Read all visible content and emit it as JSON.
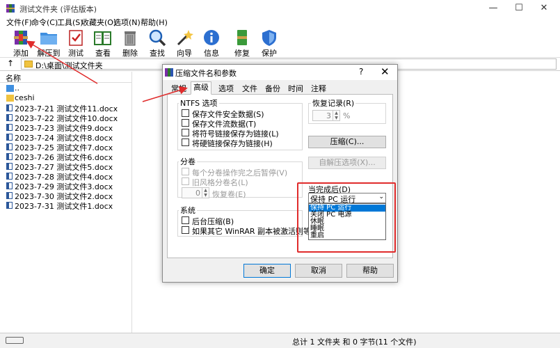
{
  "window": {
    "title": "测试文件夹 (评估版本)"
  },
  "menu": [
    "文件(F)",
    "命令(C)",
    "工具(S)",
    "收藏夹(O)",
    "选项(N)",
    "帮助(H)"
  ],
  "toolbar": [
    {
      "label": "添加",
      "icon": "add-archive-icon"
    },
    {
      "label": "解压到",
      "icon": "extract-folder-icon"
    },
    {
      "label": "测试",
      "icon": "test-icon"
    },
    {
      "label": "查看",
      "icon": "view-book-icon"
    },
    {
      "label": "删除",
      "icon": "trash-icon"
    },
    {
      "label": "查找",
      "icon": "magnifier-icon"
    },
    {
      "label": "向导",
      "icon": "wand-icon"
    },
    {
      "label": "信息",
      "icon": "info-icon"
    },
    {
      "label": "修复",
      "icon": "repair-icon"
    },
    {
      "label": "保护",
      "icon": "shield-icon"
    }
  ],
  "address": {
    "up": "↑",
    "path": "D:\\桌面\\测试文件夹"
  },
  "filelist": {
    "header": "名称",
    "items": [
      {
        "name": "..",
        "type": "up"
      },
      {
        "name": "ceshi",
        "type": "folder"
      },
      {
        "name": "2023-7-21 测试文件11.docx",
        "type": "docx"
      },
      {
        "name": "2023-7-22 测试文件10.docx",
        "type": "docx"
      },
      {
        "name": "2023-7-23 测试文件9.docx",
        "type": "docx"
      },
      {
        "name": "2023-7-24 测试文件8.docx",
        "type": "docx"
      },
      {
        "name": "2023-7-25 测试文件7.docx",
        "type": "docx"
      },
      {
        "name": "2023-7-26 测试文件6.docx",
        "type": "docx"
      },
      {
        "name": "2023-7-27 测试文件5.docx",
        "type": "docx"
      },
      {
        "name": "2023-7-28 测试文件4.docx",
        "type": "docx"
      },
      {
        "name": "2023-7-29 测试文件3.docx",
        "type": "docx"
      },
      {
        "name": "2023-7-30 测试文件2.docx",
        "type": "docx"
      },
      {
        "name": "2023-7-31 测试文件1.docx",
        "type": "docx"
      }
    ]
  },
  "status": {
    "text": "总计 1 文件夹 和 0 字节(11 个文件)"
  },
  "dialog": {
    "title": "压缩文件名和参数",
    "help": "?",
    "close": "✕",
    "tabs": [
      "常规",
      "高级",
      "选项",
      "文件",
      "备份",
      "时间",
      "注释"
    ],
    "active_tab": "高级",
    "ntfs": {
      "title": "NTFS 选项",
      "items": [
        "保存文件安全数据(S)",
        "保存文件流数据(T)",
        "将符号链接保存为链接(L)",
        "将硬链接保存为链接(H)"
      ]
    },
    "recovery": {
      "title": "恢复记录(R)",
      "value": "3",
      "unit": "%"
    },
    "compress_button": "压缩(C)...",
    "sfx_button": "自解压选项(X)...",
    "split": {
      "title": "分卷",
      "items": [
        "每个分卷操作完之后暂停(V)",
        "旧风格分卷名(L)"
      ],
      "spin_value": "0",
      "spin_label": "恢复卷(E)"
    },
    "system": {
      "title": "系统",
      "items": [
        "后台压缩(B)",
        "如果其它 WinRAR 副本被激活则等待(W)"
      ]
    },
    "after": {
      "title": "当完成后(D)",
      "selected": "保持 PC 运行",
      "options": [
        "保持 PC 运行",
        "关闭 PC 电源",
        "休眠",
        "睡眠",
        "重启"
      ]
    },
    "buttons": {
      "ok": "确定",
      "cancel": "取消",
      "help": "帮助"
    }
  },
  "colors": {
    "highlight": "#0078d7",
    "annotation": "#e02b2b"
  }
}
